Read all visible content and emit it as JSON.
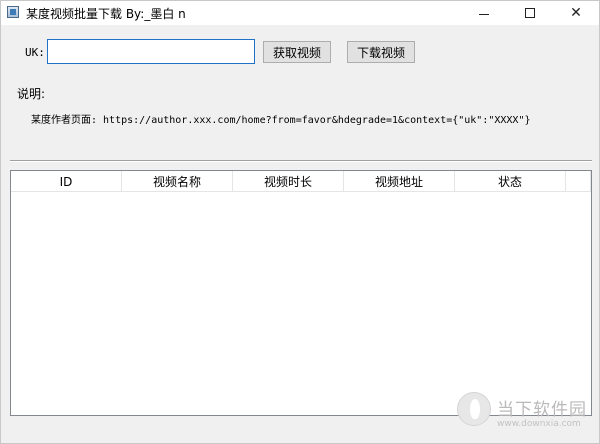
{
  "window": {
    "title": "某度视频批量下载 By:_墨白 n",
    "controls": {
      "minimize": "—",
      "maximize": "□",
      "close": "✕"
    }
  },
  "form": {
    "uk_label": "UK:",
    "uk_value": "",
    "fetch_button": "获取视频",
    "download_button": "下载视频"
  },
  "description": {
    "label": "说明:",
    "text": "某度作者页面: https://author.xxx.com/home?from=favor&hdegrade=1&context={\"uk\":\"XXXX\"}"
  },
  "table": {
    "columns": [
      "ID",
      "视频名称",
      "视频时长",
      "视频地址",
      "状态"
    ],
    "rows": []
  },
  "watermark": {
    "brand": "当下软件园",
    "url": "www.downxia.com"
  }
}
